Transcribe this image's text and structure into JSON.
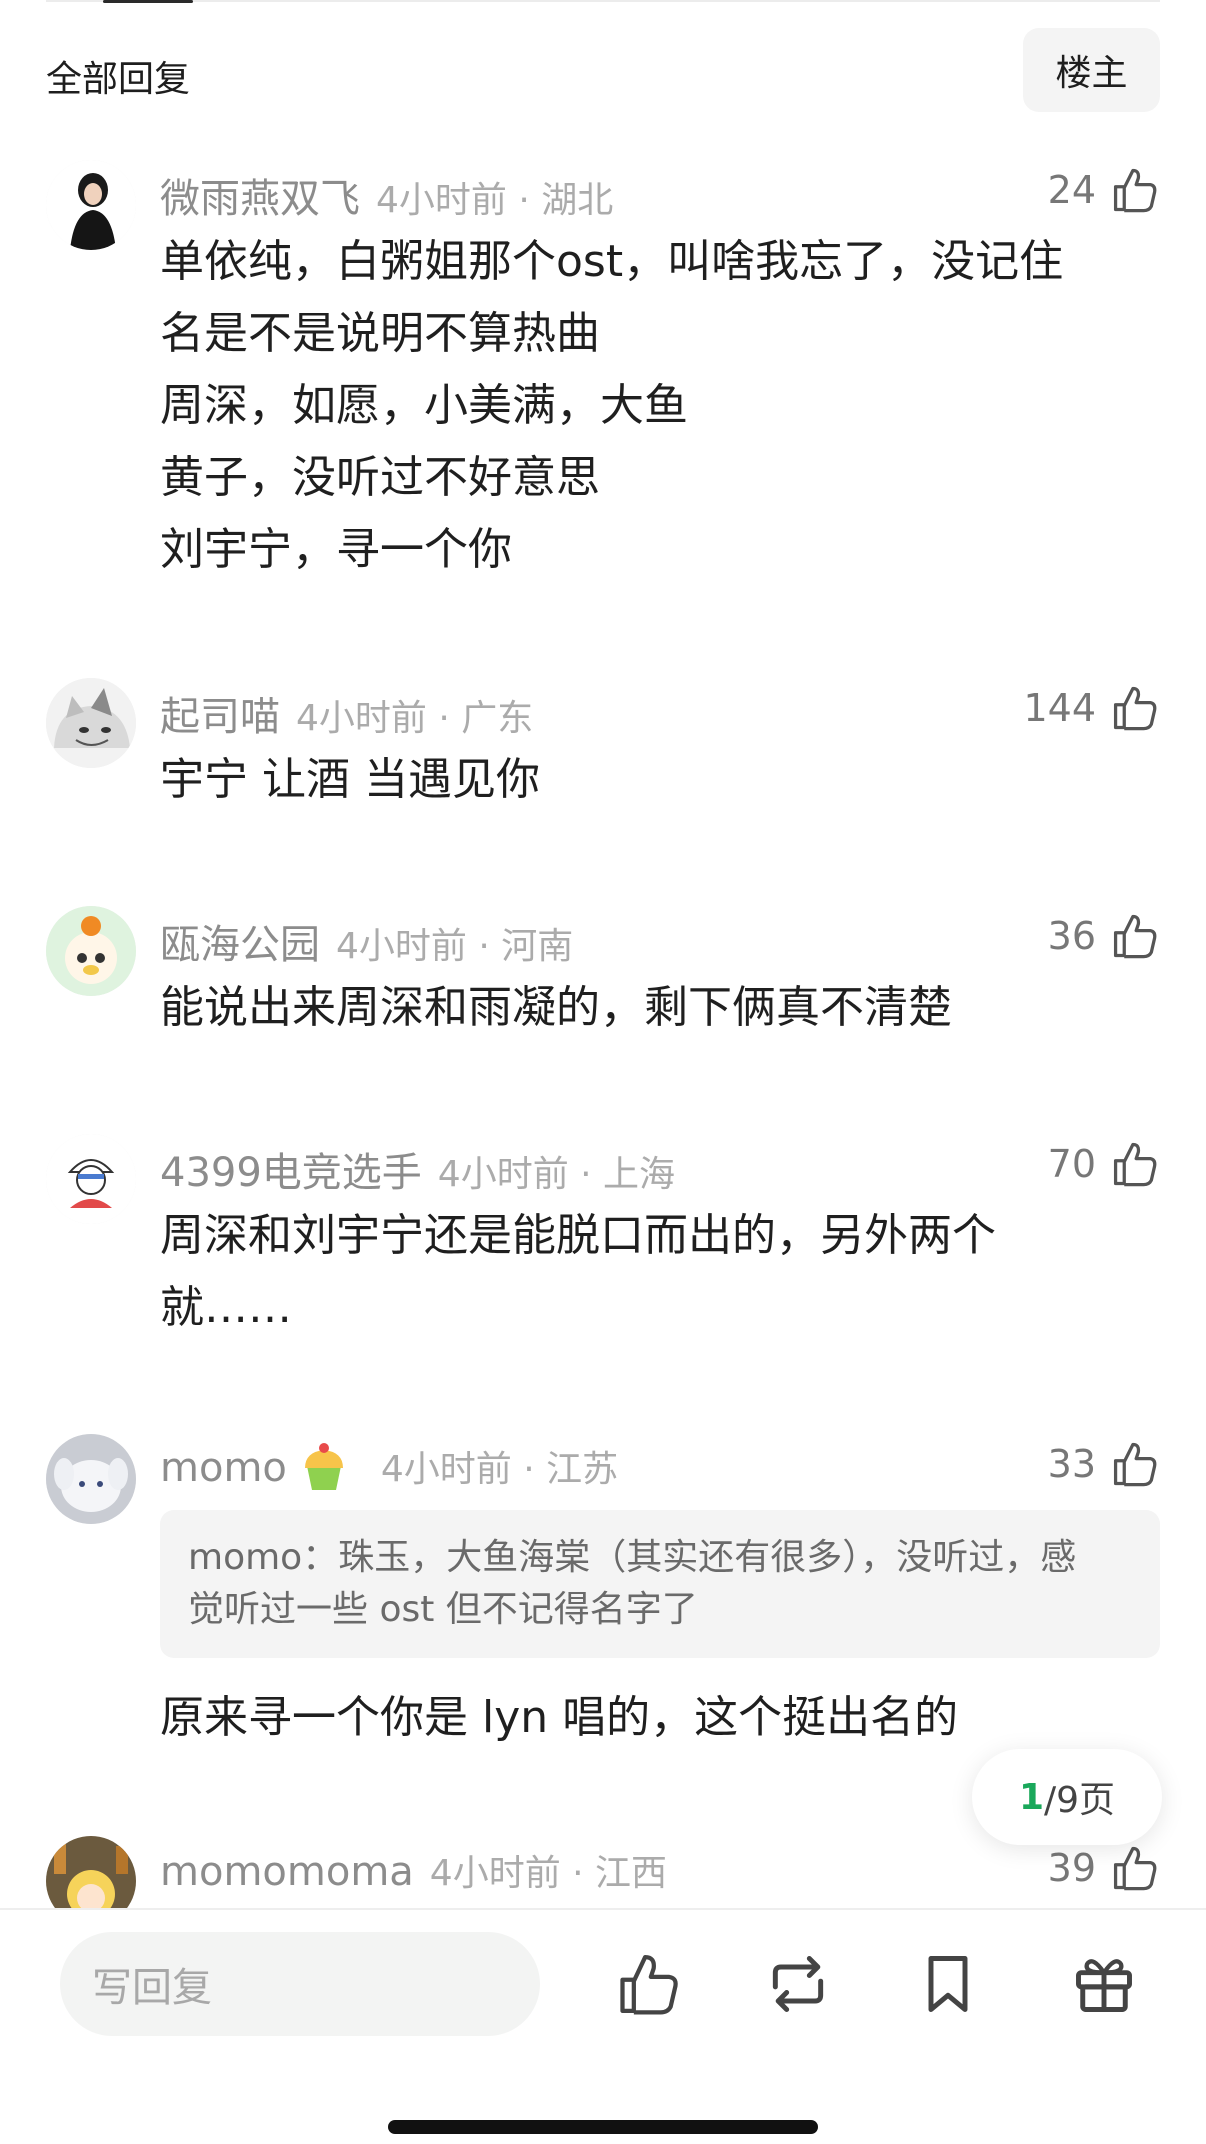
{
  "header": {
    "title": "全部回复",
    "op_button": "楼主"
  },
  "comments": [
    {
      "name": "微雨燕双飞",
      "time": "4小时前 · 湖北",
      "likes": "24",
      "avatar_icon": "user-avatar-woman",
      "content": "单依纯，白粥姐那个ost，叫啥我忘了，没记住\n名是不是说明不算热曲\n周深，如愿，小美满，大鱼\n黄子，没听过不好意思\n刘宇宁，寻一个你"
    },
    {
      "name": "起司喵",
      "time": "4小时前 · 广东",
      "likes": "144",
      "avatar_icon": "user-avatar-cat",
      "content": "宇宁 让酒  当遇见你"
    },
    {
      "name": "瓯海公园",
      "time": "4小时前 · 河南",
      "likes": "36",
      "avatar_icon": "user-avatar-sheep",
      "content": "能说出来周深和雨凝的，剩下俩真不清楚"
    },
    {
      "name": "4399电竞选手",
      "time": "4小时前 · 上海",
      "likes": "70",
      "avatar_icon": "user-avatar-cartoon",
      "content": "周深和刘宇宁还是能脱口而出的，另外两个\n就……"
    },
    {
      "name": "momo",
      "time": "4小时前 · 江苏",
      "likes": "33",
      "avatar_icon": "user-avatar-plush",
      "badge_icon": "cupcake-badge-icon",
      "quote": "momo：珠玉，大鱼海棠（其实还有很多），没听过，感\n觉听过一些 ost 但不记得名字了",
      "content": "原来寻一个你是 lyn 唱的，这个挺出名的"
    },
    {
      "name": "momomoma",
      "time": "4小时前 · 江西",
      "likes": "39",
      "avatar_icon": "user-avatar-anime",
      "content": ""
    }
  ],
  "pager": {
    "current": "1",
    "total": "/9页"
  },
  "bottom": {
    "reply_placeholder": "写回复",
    "icons": [
      "like-icon",
      "repost-icon",
      "bookmark-icon",
      "gift-icon"
    ]
  },
  "colors": {
    "accent": "#1aa85b",
    "meta_gray": "#8c8c8c"
  }
}
